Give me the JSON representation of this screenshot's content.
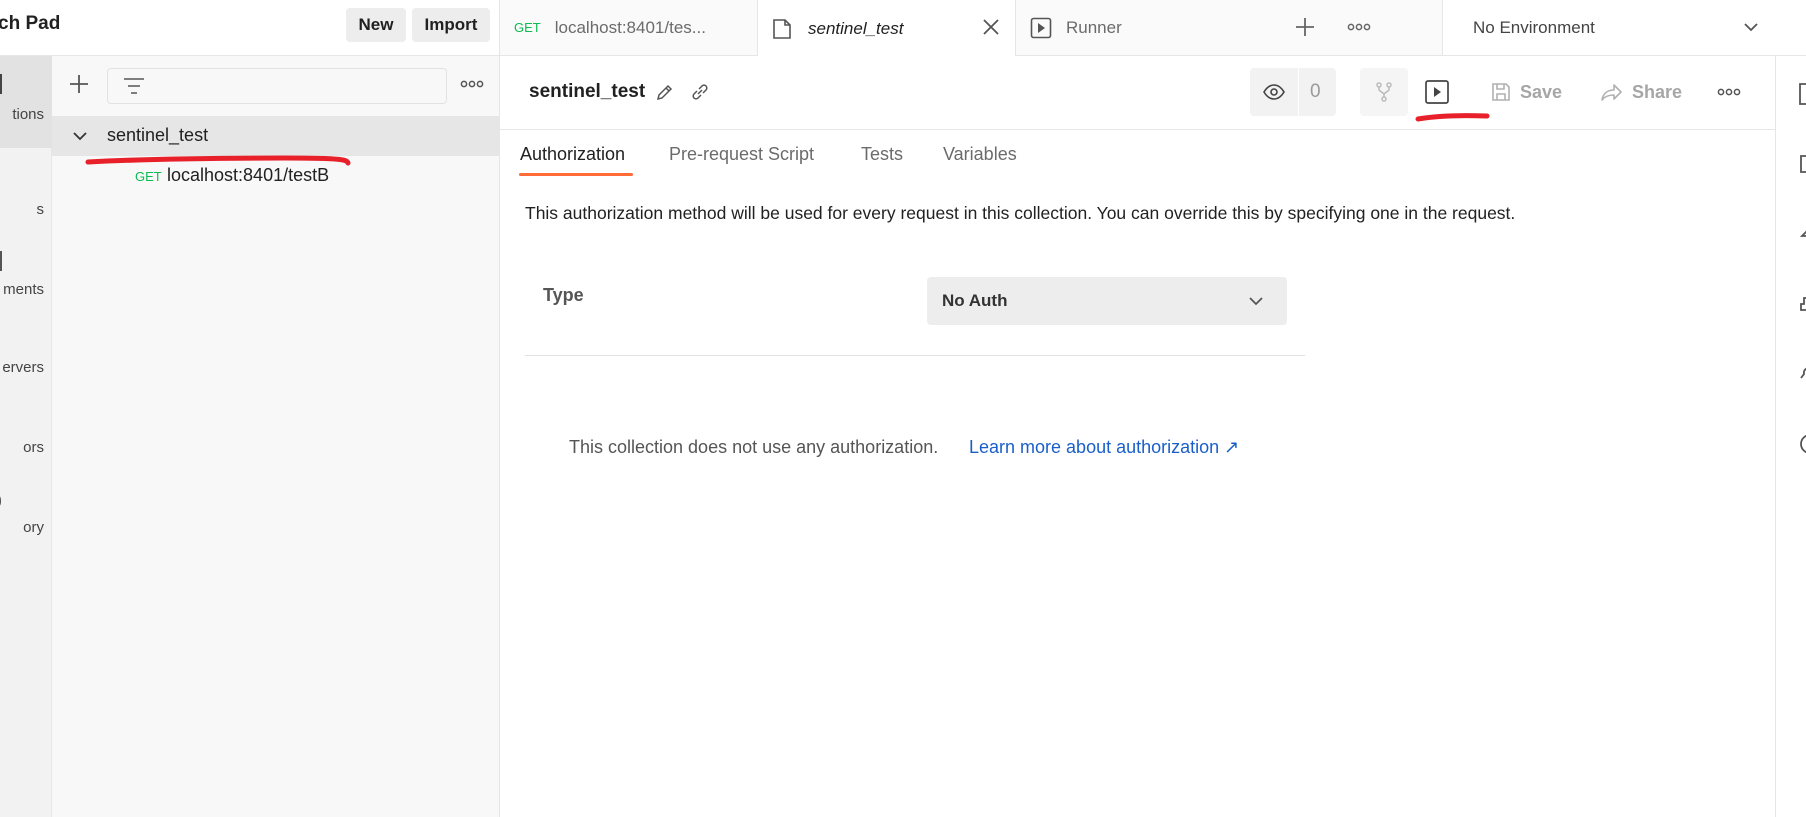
{
  "workspace": {
    "title": "ch Pad",
    "new_label": "New",
    "import_label": "Import"
  },
  "tabs": [
    {
      "method": "GET",
      "label": "localhost:8401/tes..."
    },
    {
      "label": "sentinel_test"
    },
    {
      "label": "Runner"
    }
  ],
  "environment": {
    "selected": "No Environment"
  },
  "rail": {
    "items": [
      {
        "label": "tions"
      },
      {
        "label": "s"
      },
      {
        "label": "ments"
      },
      {
        "label": "ervers"
      },
      {
        "label": "ors"
      },
      {
        "label": "ory"
      }
    ]
  },
  "sidebar": {
    "collection_name": "sentinel_test",
    "requests": [
      {
        "method": "GET",
        "url": "localhost:8401/testB"
      }
    ]
  },
  "main": {
    "title": "sentinel_test",
    "watch_count": "0",
    "save_label": "Save",
    "share_label": "Share",
    "subtabs": [
      "Authorization",
      "Pre-request Script",
      "Tests",
      "Variables"
    ],
    "auth_description": "This authorization method will be used for every request in this collection. You can override this by specifying one in the request.",
    "type_label": "Type",
    "type_value": "No Auth",
    "no_auth_text": "This collection does not use any authorization.",
    "learn_more_link": "Learn more about authorization ↗"
  },
  "colors": {
    "accent": "#ff6c37",
    "get_method": "#0cbb52",
    "link": "#1a5fc9",
    "annotation": "#e8202a"
  }
}
